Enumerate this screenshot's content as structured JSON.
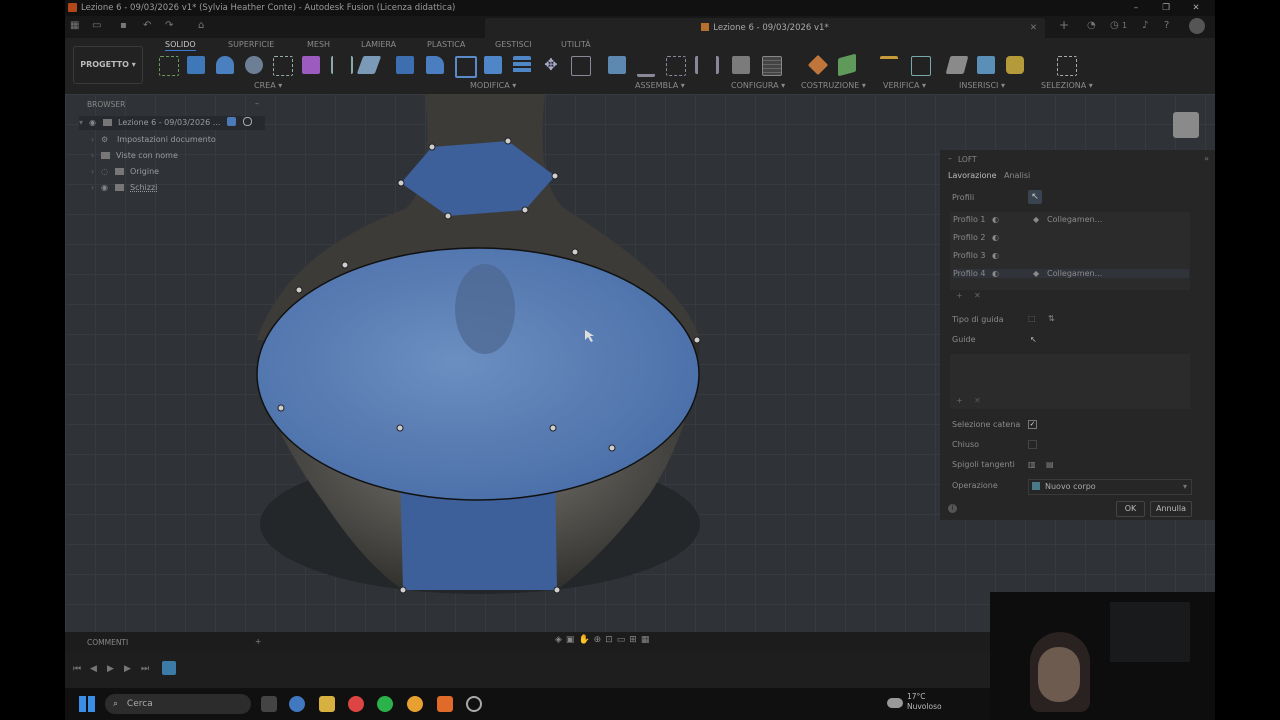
{
  "window": {
    "title": "Lezione 6 - 09/03/2026 v1* (Sylvia Heather Conte) - Autodesk Fusion (Licenza didattica)",
    "controls": [
      "–",
      "❐",
      "✕"
    ]
  },
  "doc_tab": {
    "label": "Lezione 6 - 09/03/2026 v1*",
    "close": "✕"
  },
  "tabbar_right": {
    "add": "+",
    "notifications_count": "1"
  },
  "ribbon": {
    "project_button": "PROGETTO ▾",
    "tabs": [
      "SOLIDO",
      "SUPERFICIE",
      "MESH",
      "LAMIERA",
      "PLASTICA",
      "GESTISCI",
      "UTILITÀ"
    ],
    "active_tab": "SOLIDO",
    "groups": [
      "CREA ▾",
      "MODIFICA ▾",
      "ASSEMBLA ▾",
      "CONFIGURA ▾",
      "COSTRUZIONE ▾",
      "VERIFICA ▾",
      "INSERISCI ▾",
      "SELEZIONA ▾"
    ]
  },
  "browser": {
    "header": "BROWSER",
    "items": [
      {
        "label": "Lezione 6 - 09/03/2026 ..."
      },
      {
        "label": "Impostazioni documento"
      },
      {
        "label": "Viste con nome"
      },
      {
        "label": "Origine"
      },
      {
        "label": "Schizzi"
      }
    ]
  },
  "loft_panel": {
    "title": "LOFT",
    "tabs": [
      "Lavorazione",
      "Analisi"
    ],
    "profiles_label": "Profili",
    "profiles": [
      {
        "name": "Profilo 1",
        "link": "Collegamen..."
      },
      {
        "name": "Profilo 2",
        "link": ""
      },
      {
        "name": "Profilo 3",
        "link": ""
      },
      {
        "name": "Profilo 4",
        "link": "Collegamen..."
      }
    ],
    "guide_type_label": "Tipo di guida",
    "guides_label": "Guide",
    "chain_selection_label": "Selezione catena",
    "chain_selection_checked": true,
    "closed_label": "Chiuso",
    "closed_checked": false,
    "tangent_edges_label": "Spigoli tangenti",
    "operation_label": "Operazione",
    "operation_value": "Nuovo corpo",
    "ok": "OK",
    "cancel": "Annulla"
  },
  "comments": {
    "label": "COMMENTI"
  },
  "taskbar": {
    "search_placeholder": "Cerca",
    "temperature": "17°C",
    "weather": "Nuvoloso"
  },
  "colors": {
    "profile_blue": "#3d5f9a",
    "accent": "#3c7bd8",
    "ribbon_bg": "#222222",
    "viewport_bg": "#2f3337"
  }
}
